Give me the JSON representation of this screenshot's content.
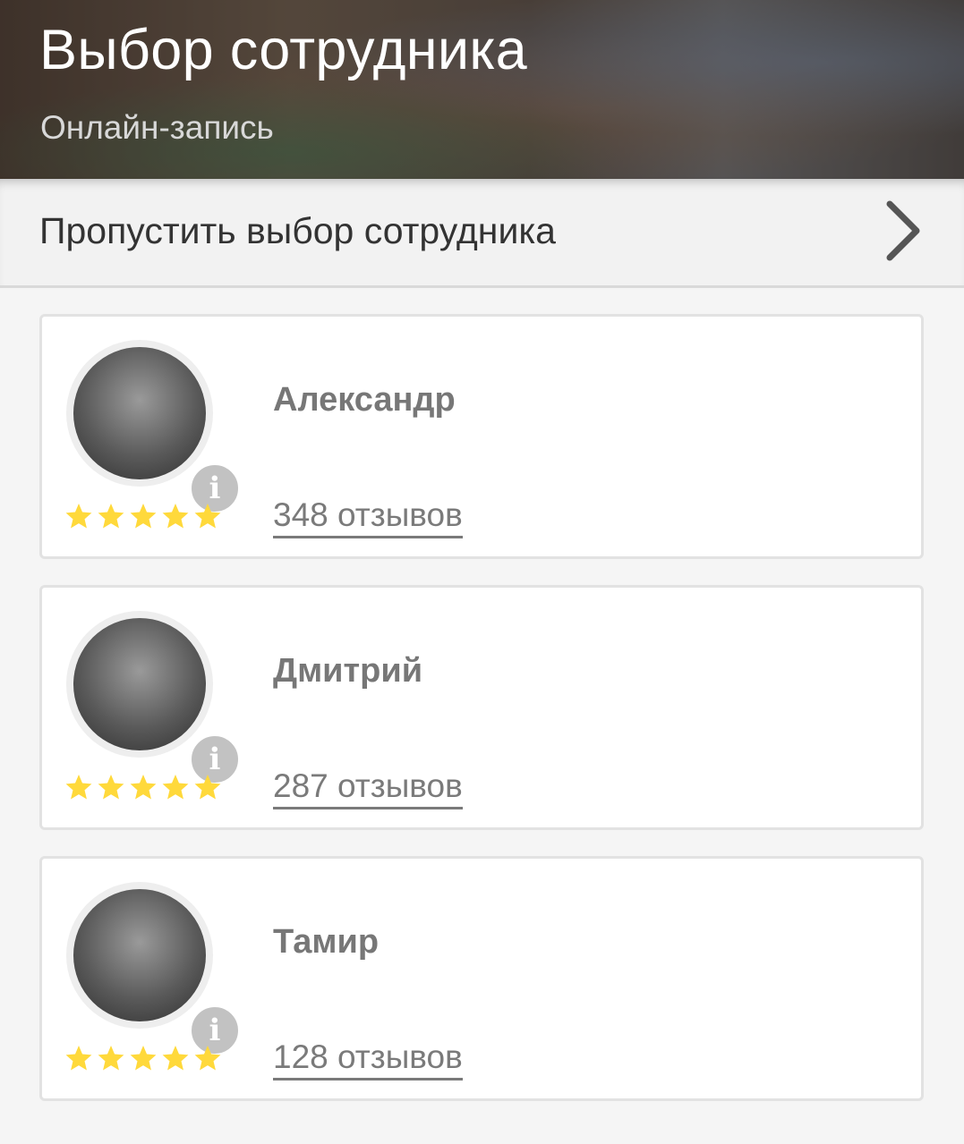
{
  "header": {
    "title": "Выбор сотрудника",
    "subtitle": "Онлайн-запись"
  },
  "skip": {
    "label": "Пропустить выбор сотрудника",
    "icon": "chevron-right-icon"
  },
  "colors": {
    "star": "#ffd93b",
    "info_badge": "#c2c2c2",
    "text_muted": "#777777"
  },
  "employees": [
    {
      "name": "Александр",
      "reviews": "348 отзывов",
      "rating": 5
    },
    {
      "name": "Дмитрий",
      "reviews": "287 отзывов",
      "rating": 5
    },
    {
      "name": "Тамир",
      "reviews": "128 отзывов",
      "rating": 5
    }
  ]
}
